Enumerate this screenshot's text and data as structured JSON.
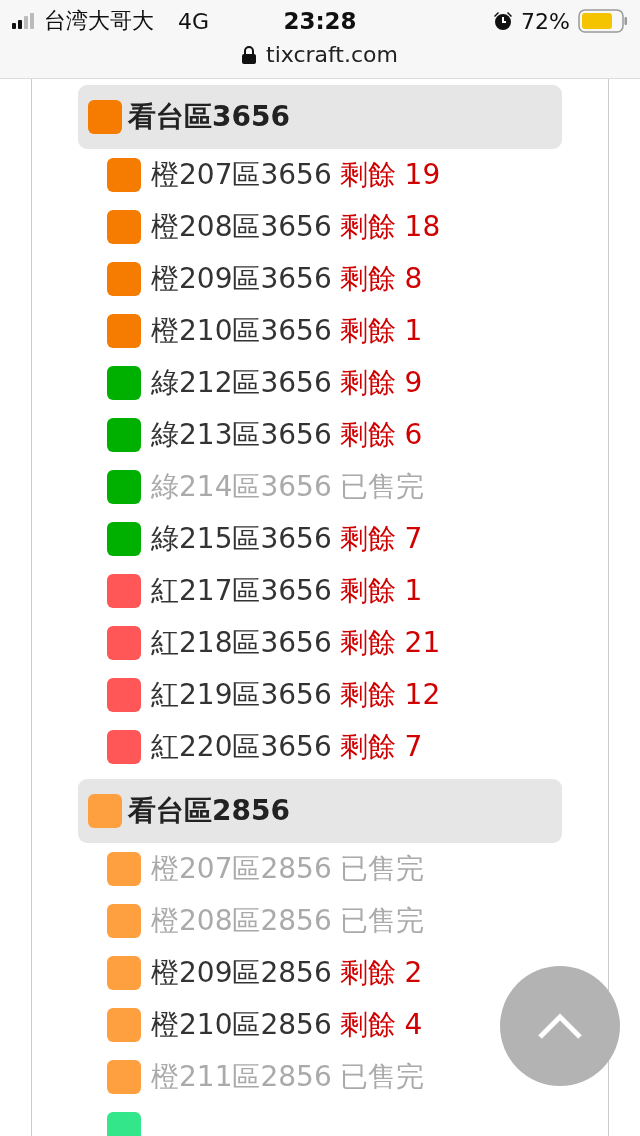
{
  "status_bar": {
    "carrier": "台湾大哥大",
    "network": "4G",
    "time": "23:28",
    "battery": "72%"
  },
  "address_bar": {
    "url": "tixcraft.com"
  },
  "sections": [
    {
      "title": "看台區3656",
      "color": "#f57c00",
      "items": [
        {
          "name": "橙207區3656",
          "status": "剩餘 19",
          "sold_out": false,
          "color": "#f57c00"
        },
        {
          "name": "橙208區3656",
          "status": "剩餘 18",
          "sold_out": false,
          "color": "#f57c00"
        },
        {
          "name": "橙209區3656",
          "status": "剩餘 8",
          "sold_out": false,
          "color": "#f57c00"
        },
        {
          "name": "橙210區3656",
          "status": "剩餘 1",
          "sold_out": false,
          "color": "#f57c00"
        },
        {
          "name": "綠212區3656",
          "status": "剩餘 9",
          "sold_out": false,
          "color": "#00b000"
        },
        {
          "name": "綠213區3656",
          "status": "剩餘 6",
          "sold_out": false,
          "color": "#00b000"
        },
        {
          "name": "綠214區3656",
          "status": "已售完",
          "sold_out": true,
          "color": "#00b000"
        },
        {
          "name": "綠215區3656",
          "status": "剩餘 7",
          "sold_out": false,
          "color": "#00b000"
        },
        {
          "name": "紅217區3656",
          "status": "剩餘 1",
          "sold_out": false,
          "color": "#ff5757"
        },
        {
          "name": "紅218區3656",
          "status": "剩餘 21",
          "sold_out": false,
          "color": "#ff5757"
        },
        {
          "name": "紅219區3656",
          "status": "剩餘 12",
          "sold_out": false,
          "color": "#ff5757"
        },
        {
          "name": "紅220區3656",
          "status": "剩餘 7",
          "sold_out": false,
          "color": "#ff5757"
        }
      ]
    },
    {
      "title": "看台區2856",
      "color": "#ffa040",
      "items": [
        {
          "name": "橙207區2856",
          "status": "已售完",
          "sold_out": true,
          "color": "#ffa040"
        },
        {
          "name": "橙208區2856",
          "status": "已售完",
          "sold_out": true,
          "color": "#ffa040"
        },
        {
          "name": "橙209區2856",
          "status": "剩餘 2",
          "sold_out": false,
          "color": "#ffa040"
        },
        {
          "name": "橙210區2856",
          "status": "剩餘 4",
          "sold_out": false,
          "color": "#ffa040"
        },
        {
          "name": "橙211區2856",
          "status": "已售完",
          "sold_out": true,
          "color": "#ffa040"
        },
        {
          "color": "#33e68a"
        }
      ]
    }
  ]
}
